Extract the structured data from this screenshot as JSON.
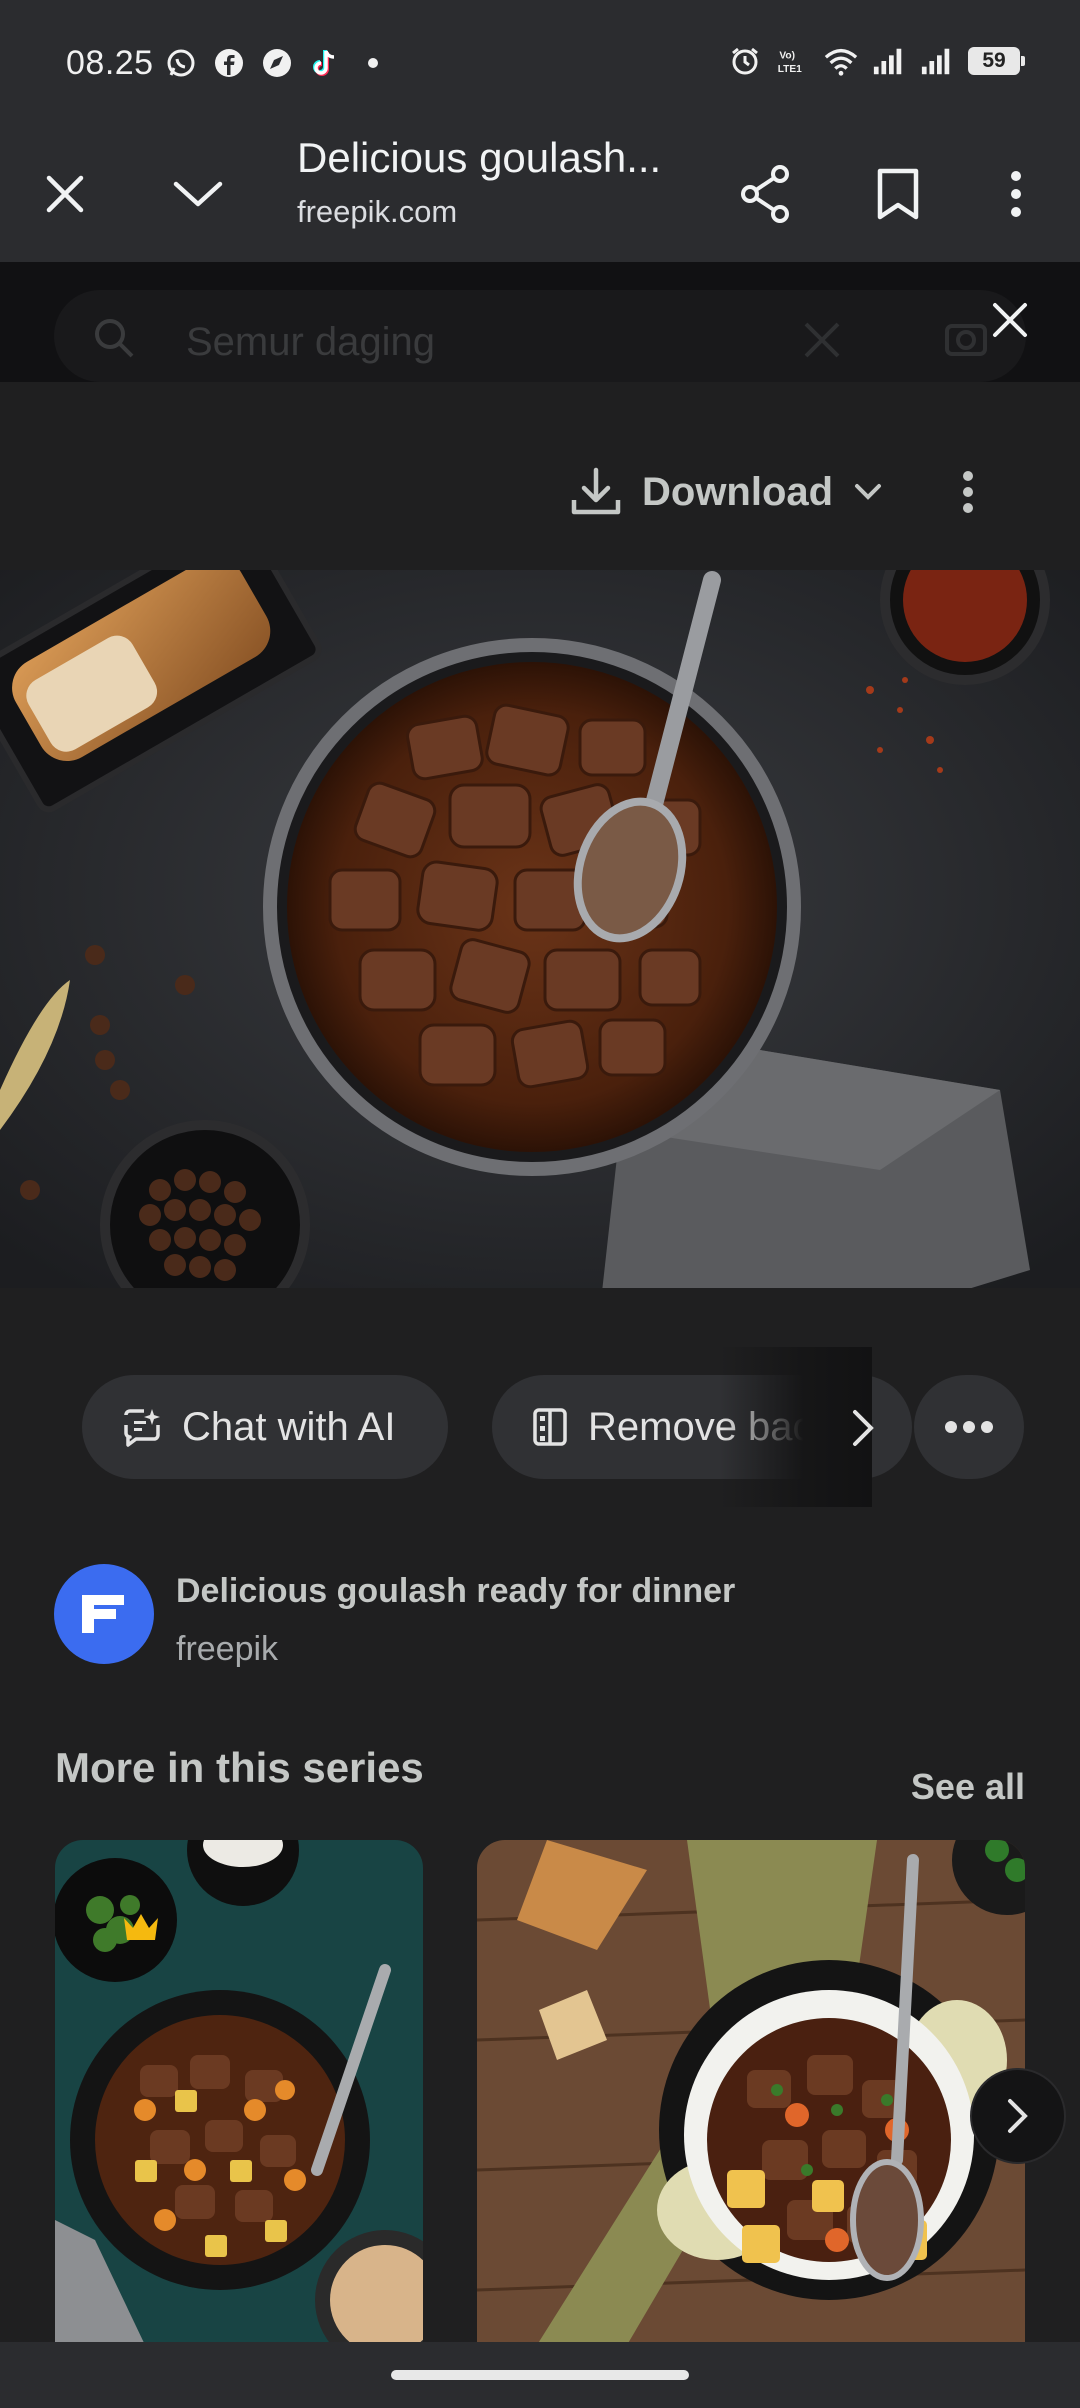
{
  "status_bar": {
    "time": "08.25",
    "battery": "59",
    "left_icons": [
      "whatsapp-icon",
      "facebook-icon",
      "compass-icon",
      "tiktok-icon",
      "dot-icon"
    ],
    "right_icons": [
      "alarm-icon",
      "volte-icon",
      "wifi-icon",
      "signal-icon",
      "signal-icon"
    ]
  },
  "toolbar": {
    "title": "Delicious goulash...",
    "url": "freepik.com"
  },
  "search": {
    "placeholder": "Semur daging"
  },
  "actions": {
    "download_label": "Download"
  },
  "chips": [
    {
      "label": "Chat with AI",
      "icon": "ai-chat-icon"
    },
    {
      "label": "Remove bac",
      "icon": "remove-background-icon"
    }
  ],
  "source": {
    "title": "Delicious goulash ready for dinner",
    "name": "freepik"
  },
  "series": {
    "heading": "More in this series",
    "see_all": "See all"
  },
  "colors": {
    "background": "#1f1f20",
    "toolbar": "#2b2c2f",
    "chip": "#303134",
    "freepik_blue": "#3b6cf0",
    "premium_crown": "#f5b90f"
  }
}
